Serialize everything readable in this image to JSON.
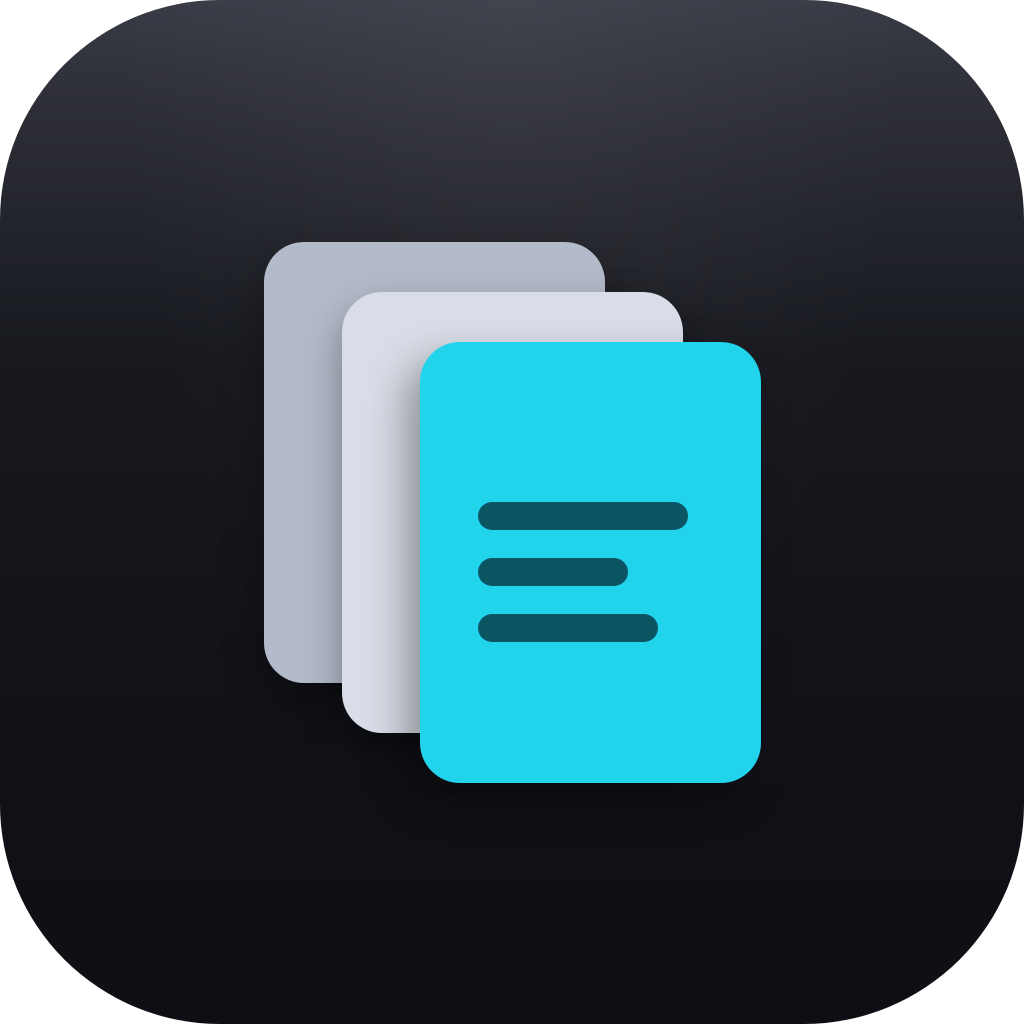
{
  "icon": {
    "name": "documents-stack-icon",
    "colors": {
      "tile_top": "#383a45",
      "tile_bottom": "#0e0f14",
      "sheet_back": "#b3bac9",
      "sheet_middle": "#d9dde7",
      "sheet_front": "#21d3eb",
      "text_lines": "#0c5565"
    },
    "text_line_count": 3
  }
}
